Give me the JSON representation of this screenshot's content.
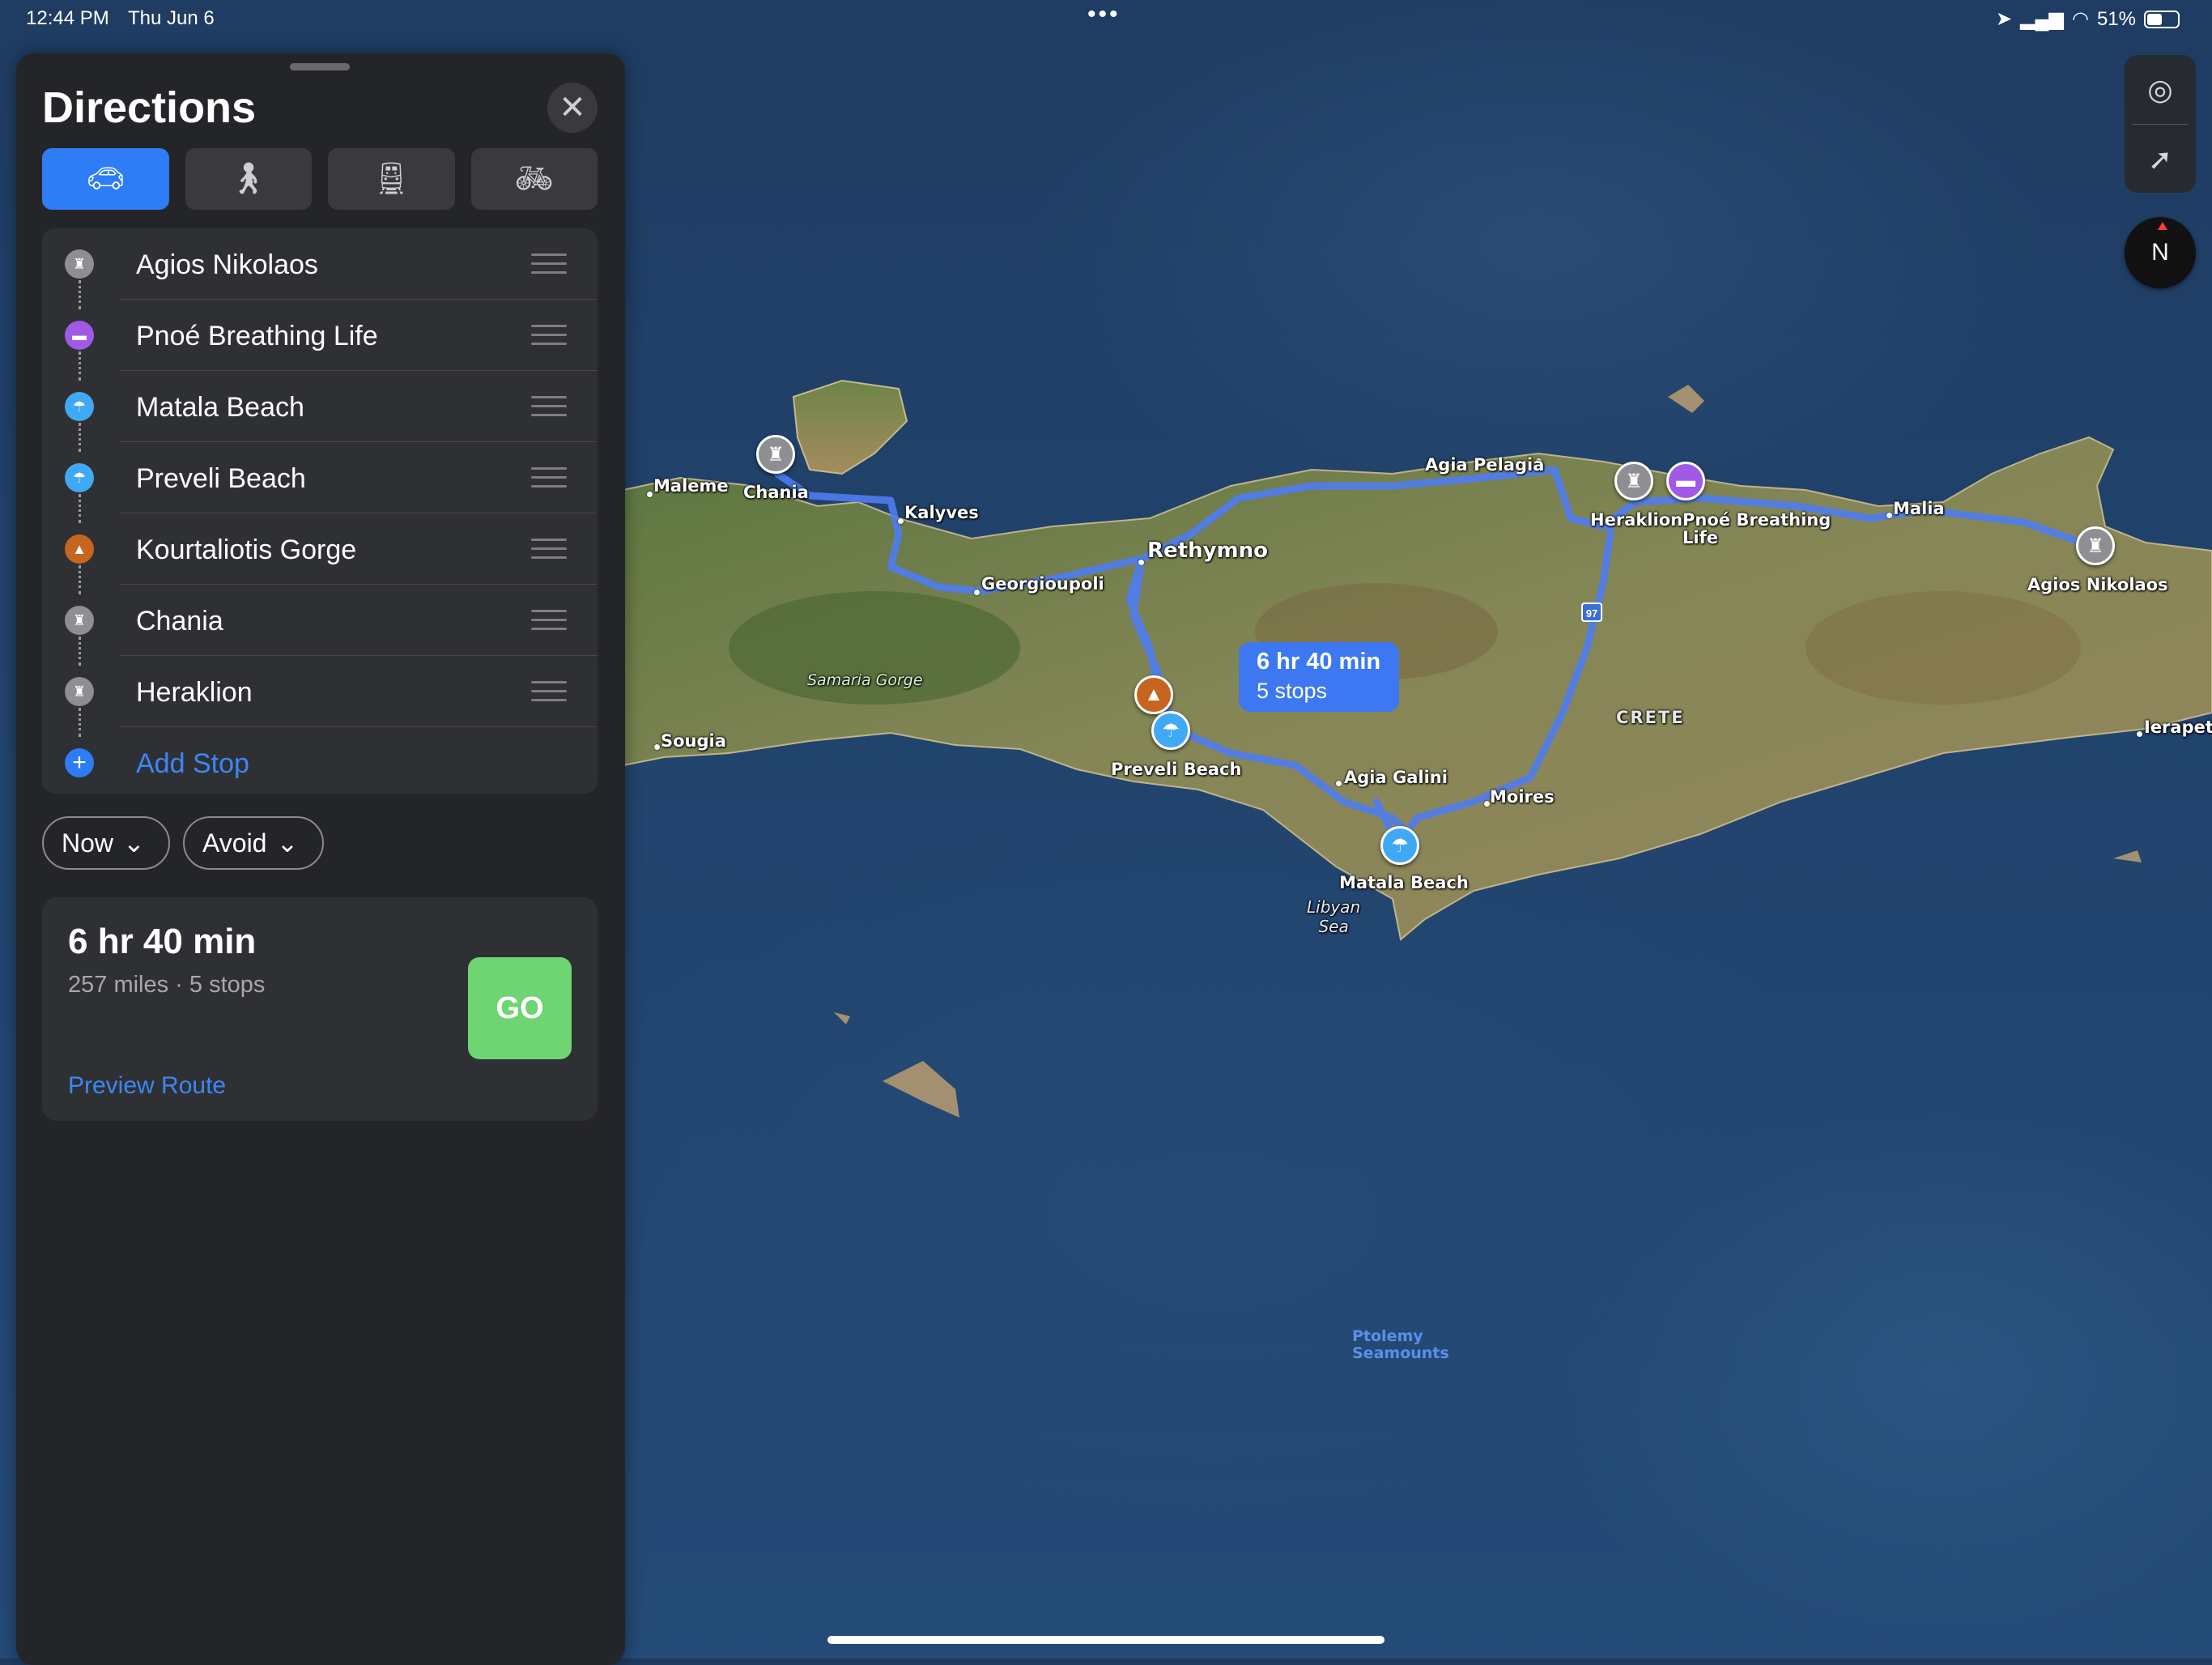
{
  "status_bar": {
    "time": "12:44 PM",
    "date": "Thu Jun 6",
    "multitask_dots": "•••",
    "battery_percent": "51%",
    "battery_level": 0.51
  },
  "panel": {
    "title": "Directions",
    "close_icon": "close-icon",
    "modes": [
      {
        "name": "drive",
        "icon": "car-icon",
        "active": true
      },
      {
        "name": "walk",
        "icon": "walk-icon",
        "active": false
      },
      {
        "name": "transit",
        "icon": "train-icon",
        "active": false
      },
      {
        "name": "cycle",
        "icon": "bicycle-icon",
        "active": false
      }
    ],
    "stops": [
      {
        "label": "Agios Nikolaos",
        "icon": "city-icon"
      },
      {
        "label": "Pnoé Breathing Life",
        "icon": "bed-icon"
      },
      {
        "label": "Matala Beach",
        "icon": "beach-umbrella-icon"
      },
      {
        "label": "Preveli Beach",
        "icon": "beach-umbrella-icon"
      },
      {
        "label": "Kourtaliotis Gorge",
        "icon": "mountain-icon"
      },
      {
        "label": "Chania",
        "icon": "city-icon"
      },
      {
        "label": "Heraklion",
        "icon": "city-icon"
      }
    ],
    "add_stop_label": "Add Stop",
    "now_label": "Now",
    "avoid_label": "Avoid",
    "summary": {
      "duration": "6 hr 40 min",
      "details": "257 miles · 5 stops",
      "go_label": "GO",
      "preview_label": "Preview Route"
    }
  },
  "map": {
    "route_callout": {
      "duration": "6 hr 40 min",
      "stops": "5 stops"
    },
    "labels": {
      "maleme": "Maleme",
      "chania": "Chania",
      "kalyves": "Kalyves",
      "georgioupoli": "Georgioupoli",
      "rethymno": "Rethymno",
      "agia_pelagia": "Agia Pelagia",
      "heraklion": "Heraklion",
      "pnoe_line1": "Pnoé Breathing",
      "pnoe_line2": "Life",
      "malia": "Malia",
      "agios_nikolaos": "Agios Nikolaos",
      "ierapetra": "Ierapetr",
      "crete": "CRETE",
      "samaria_gorge": "Samaria Gorge",
      "sougia": "Sougia",
      "preveli_beach": "Preveli Beach",
      "agia_galini": "Agia Galini",
      "moires": "Moires",
      "matala_beach": "Matala Beach",
      "libyan_sea_line1": "Libyan",
      "libyan_sea_line2": "Sea",
      "ptolemy_line1": "Ptolemy",
      "ptolemy_line2": "Seamounts",
      "route_shield": "97"
    },
    "colors": {
      "route": "#4f7cf0",
      "accent_blue": "#2e7cf6",
      "go_green": "#6fd472"
    },
    "controls": [
      "globe-icon",
      "location-arrow-icon"
    ],
    "compass_label": "N"
  }
}
